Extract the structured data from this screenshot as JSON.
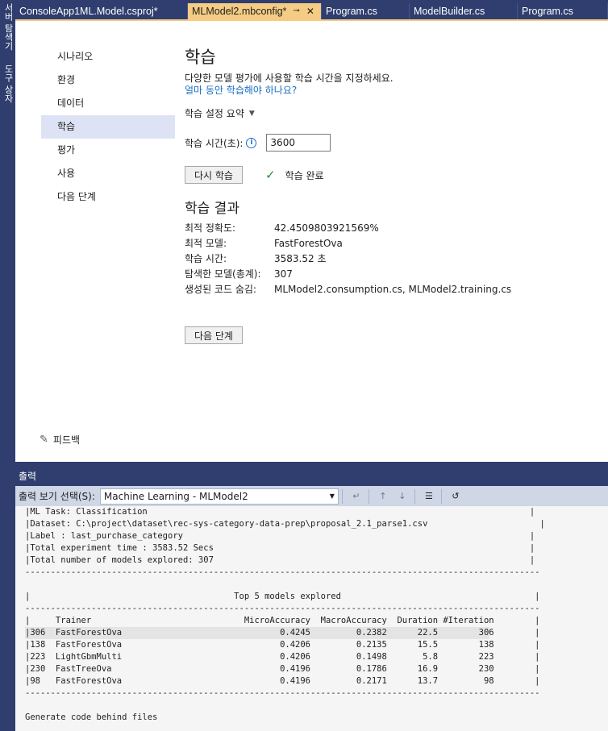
{
  "side_strip": {
    "tabs": [
      "서버 탐색기",
      "도구 상자"
    ]
  },
  "tabs": [
    {
      "label": "ConsoleApp1ML.Model.csproj*",
      "active": false
    },
    {
      "label": "MLModel2.mbconfig*",
      "active": true,
      "pin": "⊸",
      "close": "✕"
    },
    {
      "label": "Program.cs",
      "active": false
    },
    {
      "label": "ModelBuilder.cs",
      "active": false
    },
    {
      "label": "Program.cs",
      "active": false
    }
  ],
  "nav": [
    {
      "label": "시나리오"
    },
    {
      "label": "환경"
    },
    {
      "label": "데이터"
    },
    {
      "label": "학습",
      "selected": true
    },
    {
      "label": "평가"
    },
    {
      "label": "사용"
    },
    {
      "label": "다음 단계"
    }
  ],
  "page": {
    "title": "학습",
    "description": "다양한 모델 평가에 사용할 학습 시간을 지정하세요.",
    "help_link": "얼마 동안 학습해야 하나요?",
    "summary_label": "학습 설정 요약",
    "time_label": "학습 시간(초):",
    "time_value": "3600",
    "retrain_button": "다시 학습",
    "status": "학습 완료",
    "results_title": "학습 결과",
    "results": [
      {
        "label": "최적 정확도:",
        "value": "42.4509803921569%"
      },
      {
        "label": "최적 모델:",
        "value": "FastForestOva"
      },
      {
        "label": "학습 시간:",
        "value": "3583.52 초"
      },
      {
        "label": "탐색한 모델(총계):",
        "value": "307"
      },
      {
        "label": "생성된 코드 숨김:",
        "value": "MLModel2.consumption.cs, MLModel2.training.cs"
      }
    ],
    "next_button": "다음 단계",
    "feedback": "피드백"
  },
  "output": {
    "title": "출력",
    "source_label": "출력 보기 선택(S):",
    "source_value": "Machine Learning - MLModel2",
    "lines": [
      "|ML Task: Classification                                                                           |",
      "|Dataset: C:\\project\\dataset\\rec-sys-category-data-prep\\proposal_2.1_parse1.csv                      |",
      "|Label : last_purchase_category                                                                    |",
      "|Total experiment time : 3583.52 Secs                                                              |",
      "|Total number of models explored: 307                                                              |",
      "-----------------------------------------------------------------------------------------------------",
      "",
      "|                                        Top 5 models explored                                      |",
      "-----------------------------------------------------------------------------------------------------",
      "|     Trainer                              MicroAccuracy  MacroAccuracy  Duration #Iteration        |",
      "|306  FastForestOva                               0.4245         0.2382      22.5        306        |",
      "|138  FastForestOva                               0.4206         0.2135      15.5        138        |",
      "|223  LightGbmMulti                               0.4206         0.1498       5.8        223        |",
      "|230  FastTreeOva                                 0.4196         0.1786      16.9        230        |",
      "|98   FastForestOva                               0.4196         0.2171      13.7         98        |",
      "-----------------------------------------------------------------------------------------------------",
      "",
      "Generate code behind files"
    ],
    "highlighted_line": 10
  }
}
